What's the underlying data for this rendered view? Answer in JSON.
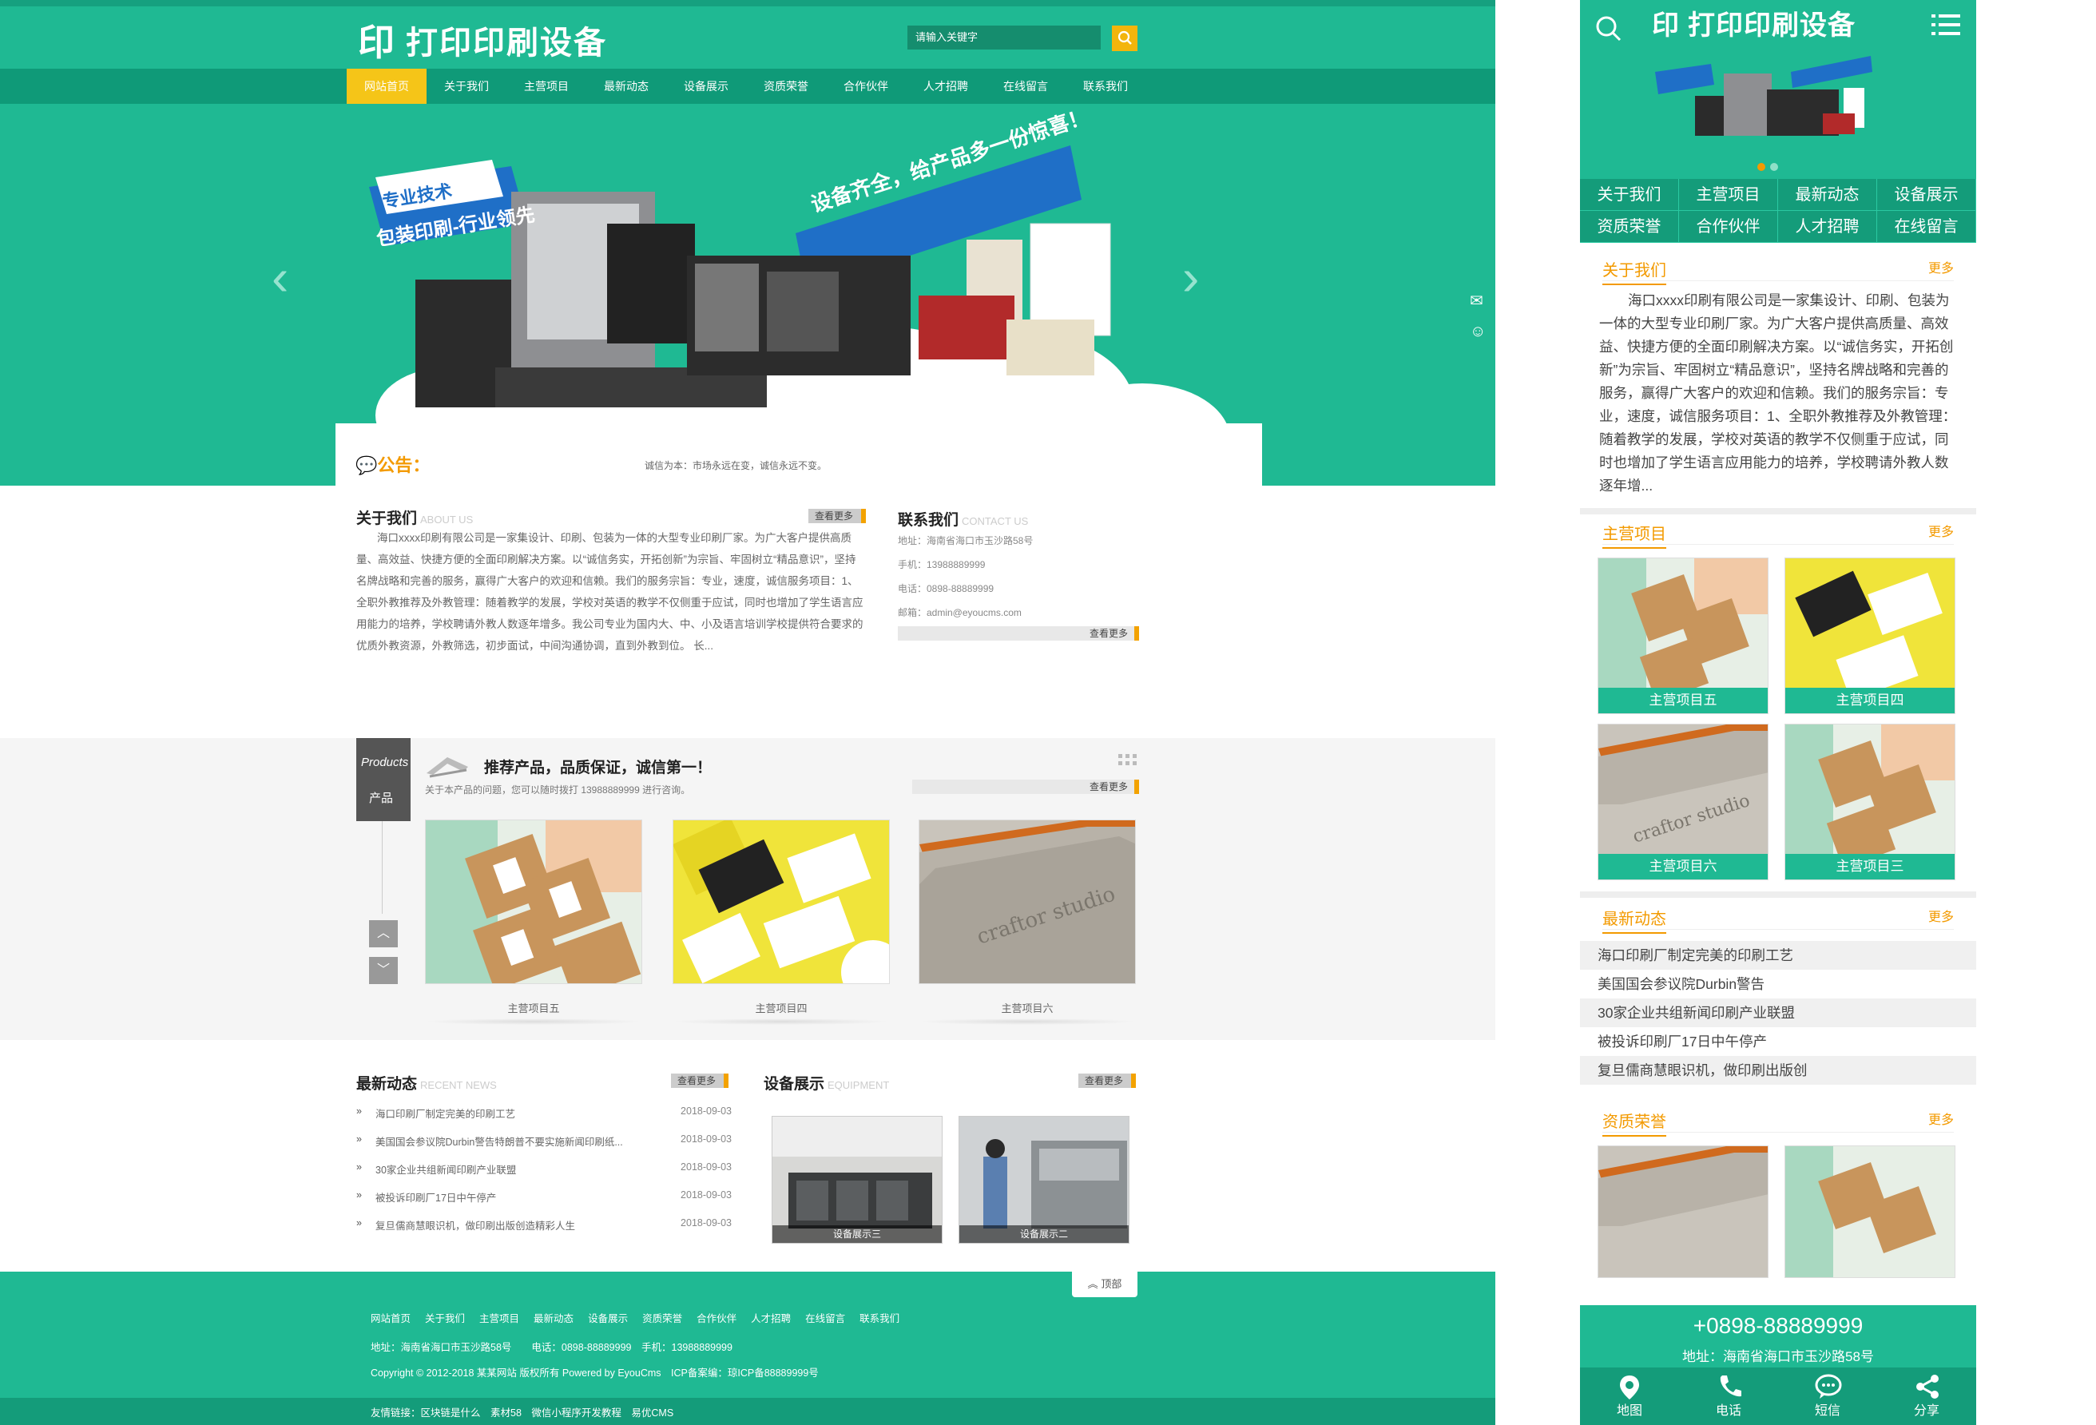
{
  "desktop": {
    "logo": {
      "glyph": "印",
      "name": "打印印刷设备"
    },
    "search": {
      "placeholder": "请输入关键字"
    },
    "nav": [
      "网站首页",
      "关于我们",
      "主营项目",
      "最新动态",
      "设备展示",
      "资质荣誉",
      "合作伙伴",
      "人才招聘",
      "在线留言",
      "联系我们"
    ],
    "banner": {
      "slogan_left_1": "专业技术",
      "slogan_left_2": "包装印刷-行业领先",
      "slogan_right": "设备齐全，给产品多一份惊喜！"
    },
    "notice": {
      "title": "公告：",
      "text": "诚信为本：市场永远在变，诚信永远不变。"
    },
    "about": {
      "title": "关于我们",
      "title_en": "ABOUT US",
      "more": "查看更多",
      "text": "海口xxxx印刷有限公司是一家集设计、印刷、包装为一体的大型专业印刷厂家。为广大客户提供高质量、高效益、快捷方便的全面印刷解决方案。以“诚信务实，开拓创新”为宗旨、牢固树立“精品意识”，坚持名牌战略和完善的服务，赢得广大客户的欢迎和信赖。我们的服务宗旨：专业，速度，诚信服务项目：1、全职外教推荐及外教管理：随着教学的发展，学校对英语的教学不仅侧重于应试，同时也增加了学生语言应用能力的培养，学校聘请外教人数逐年增多。我公司专业为国内大、中、小及语言培训学校提供符合要求的优质外教资源，外教筛选，初步面试，中间沟通协调，直到外教到位。 长..."
    },
    "contact": {
      "title": "联系我们",
      "title_en": "CONTACT US",
      "more": "查看更多",
      "address": "地址：海南省海口市玉沙路58号",
      "mobile": "手机：13988889999",
      "phone": "电话：0898-88889999",
      "email": "邮箱：admin@eyoucms.com"
    },
    "products": {
      "badge_en": "Products",
      "badge_cn": "产品",
      "headline": "推荐产品，品质保证，诚信第一！",
      "sub": "关于本产品的问题，您可以随时拨打 13988889999 进行咨询。",
      "more": "查看更多",
      "items": [
        "主营项目五",
        "主营项目四",
        "主营项目六"
      ]
    },
    "news": {
      "title": "最新动态",
      "title_en": "RECENT NEWS",
      "more": "查看更多",
      "marker": "»",
      "items": [
        {
          "title": "海口印刷厂制定完美的印刷工艺",
          "date": "2018-09-03"
        },
        {
          "title": "美国国会参议院Durbin警告特朗普不要实施新闻印刷纸...",
          "date": "2018-09-03"
        },
        {
          "title": "30家企业共组新闻印刷产业联盟",
          "date": "2018-09-03"
        },
        {
          "title": "被投诉印刷厂17日中午停产",
          "date": "2018-09-03"
        },
        {
          "title": "复旦儒商慧眼识机，做印刷出版创造精彩人生",
          "date": "2018-09-03"
        }
      ]
    },
    "equipment": {
      "title": "设备展示",
      "title_en": "EQUIPMENT",
      "more": "查看更多",
      "items": [
        "设备展示三",
        "设备展示二"
      ]
    },
    "back_top": "顶部",
    "footer": {
      "nav": [
        "网站首页",
        "关于我们",
        "主营项目",
        "最新动态",
        "设备展示",
        "资质荣誉",
        "合作伙伴",
        "人才招聘",
        "在线留言",
        "联系我们"
      ],
      "info": "地址：海南省海口市玉沙路58号　　电话：0898-88889999　手机：13988889999",
      "copyright": "Copyright © 2012-2018 某某网站 版权所有 Powered by EyouCms　ICP备案编：琼ICP备88889999号",
      "links": "友情链接：区块链是什么　素材58　微信小程序开发教程　易优CMS"
    }
  },
  "mobile": {
    "logo": {
      "glyph": "印",
      "name": "打印印刷设备"
    },
    "grid": [
      "关于我们",
      "主营项目",
      "最新动态",
      "设备展示",
      "资质荣誉",
      "合作伙伴",
      "人才招聘",
      "在线留言"
    ],
    "about": {
      "title": "关于我们",
      "more": "更多",
      "text": "海口xxxx印刷有限公司是一家集设计、印刷、包装为一体的大型专业印刷厂家。为广大客户提供高质量、高效益、快捷方便的全面印刷解决方案。以“诚信务实，开拓创新”为宗旨、牢固树立“精品意识”，坚持名牌战略和完善的服务，赢得广大客户的欢迎和信赖。我们的服务宗旨：专业，速度，诚信服务项目：1、全职外教推荐及外教管理：随着教学的发展，学校对英语的教学不仅侧重于应试，同时也增加了学生语言应用能力的培养，学校聘请外教人数逐年增..."
    },
    "products": {
      "title": "主营项目",
      "more": "更多",
      "items": [
        "主营项目五",
        "主营项目四",
        "主营项目六",
        "主营项目三"
      ]
    },
    "news": {
      "title": "最新动态",
      "more": "更多",
      "items": [
        "海口印刷厂制定完美的印刷工艺",
        "美国国会参议院Durbin警告",
        "30家企业共组新闻印刷产业联盟",
        "被投诉印刷厂17日中午停产",
        "复旦儒商慧眼识机，做印刷出版创"
      ]
    },
    "honors": {
      "title": "资质荣誉",
      "more": "更多"
    },
    "contact": {
      "phone": "+0898-88889999",
      "address": "地址：海南省海口市玉沙路58号"
    },
    "tabs": [
      "地图",
      "电话",
      "短信",
      "分享"
    ]
  },
  "colors": {
    "brand": "#1fb993",
    "brand_dark": "#0f9a78",
    "accent": "#f3b50c",
    "orange": "#f39a00"
  }
}
